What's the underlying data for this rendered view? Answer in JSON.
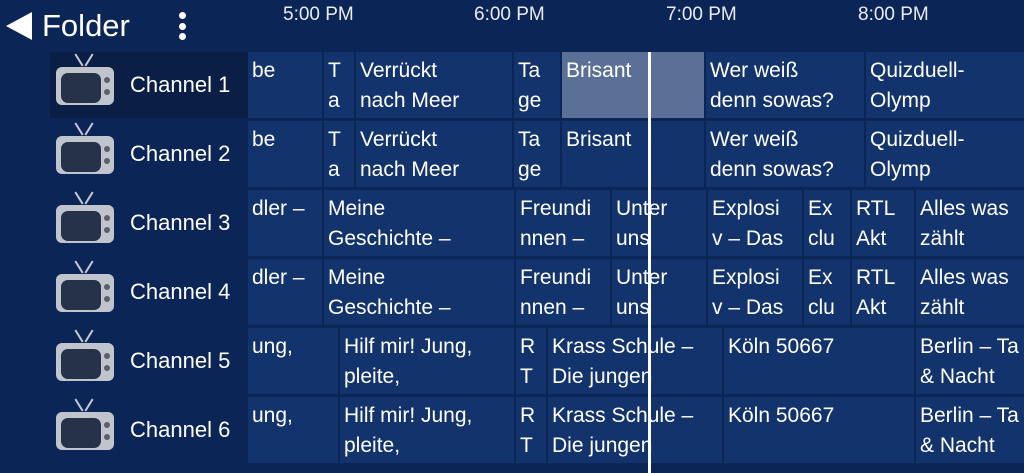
{
  "header": {
    "back_label": "Folder",
    "times": [
      "5:00 PM",
      "6:00 PM",
      "7:00 PM",
      "8:00 PM"
    ]
  },
  "channels": [
    "Channel 1",
    "Channel 2",
    "Channel 3",
    "Channel 4",
    "Channel 5",
    "Channel 6"
  ],
  "rows": [
    [
      {
        "text": "be"
      },
      {
        "text": "T\na"
      },
      {
        "text": "Verrückt\nnach Meer"
      },
      {
        "text": "Ta\nge"
      },
      {
        "text": "Brisant",
        "selected": true
      },
      {
        "text": "Wer weiß\ndenn sowas?"
      },
      {
        "text": "Quizduell-\nOlymp"
      }
    ],
    [
      {
        "text": "be"
      },
      {
        "text": "T\na"
      },
      {
        "text": "Verrückt\nnach Meer"
      },
      {
        "text": "Ta\nge"
      },
      {
        "text": "Brisant"
      },
      {
        "text": "Wer weiß\ndenn sowas?"
      },
      {
        "text": "Quizduell-\nOlymp"
      }
    ],
    [
      {
        "text": "dler –"
      },
      {
        "text": "Meine\nGeschichte –"
      },
      {
        "text": "Freundi\nnnen –"
      },
      {
        "text": "Unter\nuns"
      },
      {
        "text": "Explosi\nv – Das"
      },
      {
        "text": "Ex\nclu"
      },
      {
        "text": "RTL\nAkt"
      },
      {
        "text": "Alles was\nzählt"
      }
    ],
    [
      {
        "text": "dler –"
      },
      {
        "text": "Meine\nGeschichte –"
      },
      {
        "text": "Freundi\nnnen –"
      },
      {
        "text": "Unter\nuns"
      },
      {
        "text": "Explosi\nv – Das"
      },
      {
        "text": "Ex\nclu"
      },
      {
        "text": "RTL\nAkt"
      },
      {
        "text": "Alles was\nzählt"
      }
    ],
    [
      {
        "text": "ung,"
      },
      {
        "text": "Hilf mir! Jung,\npleite,"
      },
      {
        "text": "R\nT"
      },
      {
        "text": "Krass Schule –\nDie jungen"
      },
      {
        "text": "Köln 50667"
      },
      {
        "text": "Berlin – Ta\n& Nacht"
      }
    ],
    [
      {
        "text": "ung,"
      },
      {
        "text": "Hilf mir! Jung,\npleite,"
      },
      {
        "text": "R\nT"
      },
      {
        "text": "Krass Schule –\nDie jungen"
      },
      {
        "text": "Köln 50667"
      },
      {
        "text": "Berlin – Ta\n& Nacht"
      }
    ]
  ]
}
